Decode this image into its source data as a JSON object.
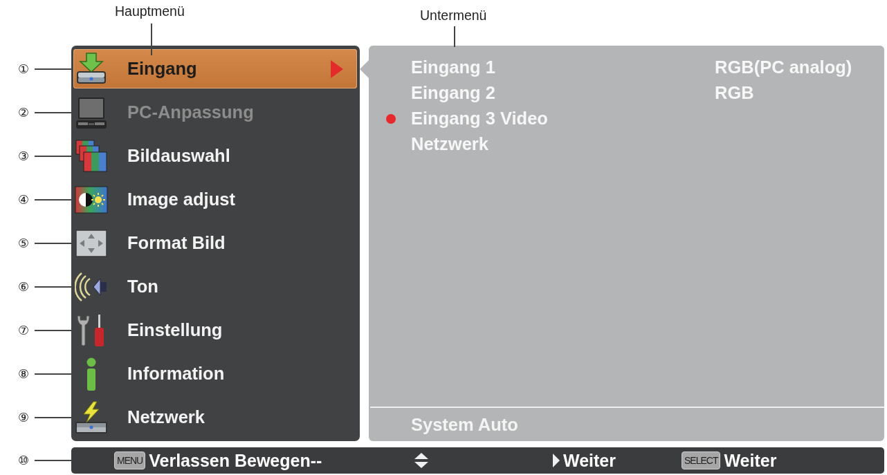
{
  "main_menu": {
    "caption": "Hauptmenü",
    "items": [
      {
        "callout": "①",
        "label": "Eingang",
        "selected": true,
        "disabled": false
      },
      {
        "callout": "②",
        "label": "PC-Anpassung",
        "selected": false,
        "disabled": true
      },
      {
        "callout": "③",
        "label": "Bildauswahl",
        "selected": false,
        "disabled": false
      },
      {
        "callout": "④",
        "label": "Image adjust",
        "selected": false,
        "disabled": false
      },
      {
        "callout": "⑤",
        "label": "Format Bild",
        "selected": false,
        "disabled": false
      },
      {
        "callout": "⑥",
        "label": "Ton",
        "selected": false,
        "disabled": false
      },
      {
        "callout": "⑦",
        "label": "Einstellung",
        "selected": false,
        "disabled": false
      },
      {
        "callout": "⑧",
        "label": "Information",
        "selected": false,
        "disabled": false
      },
      {
        "callout": "⑨",
        "label": "Netzwerk",
        "selected": false,
        "disabled": false
      }
    ]
  },
  "submenu": {
    "caption": "Untermenü",
    "items": [
      {
        "label": "Eingang 1",
        "value": "RGB(PC analog)",
        "selected": false
      },
      {
        "label": "Eingang 2",
        "value": "RGB",
        "selected": false
      },
      {
        "label": "Eingang 3 Video",
        "selected": true
      },
      {
        "label": "Netzwerk",
        "selected": false
      }
    ],
    "footer": "System Auto"
  },
  "hint_bar": {
    "callout": "⑩",
    "hints": [
      {
        "kind": "key",
        "key": "MENU",
        "label": "Verlassen Bewegen--"
      },
      {
        "kind": "updown"
      },
      {
        "kind": "arrow",
        "label": "Weiter"
      },
      {
        "kind": "key",
        "key": "SELECT",
        "label": "Weiter"
      }
    ]
  }
}
